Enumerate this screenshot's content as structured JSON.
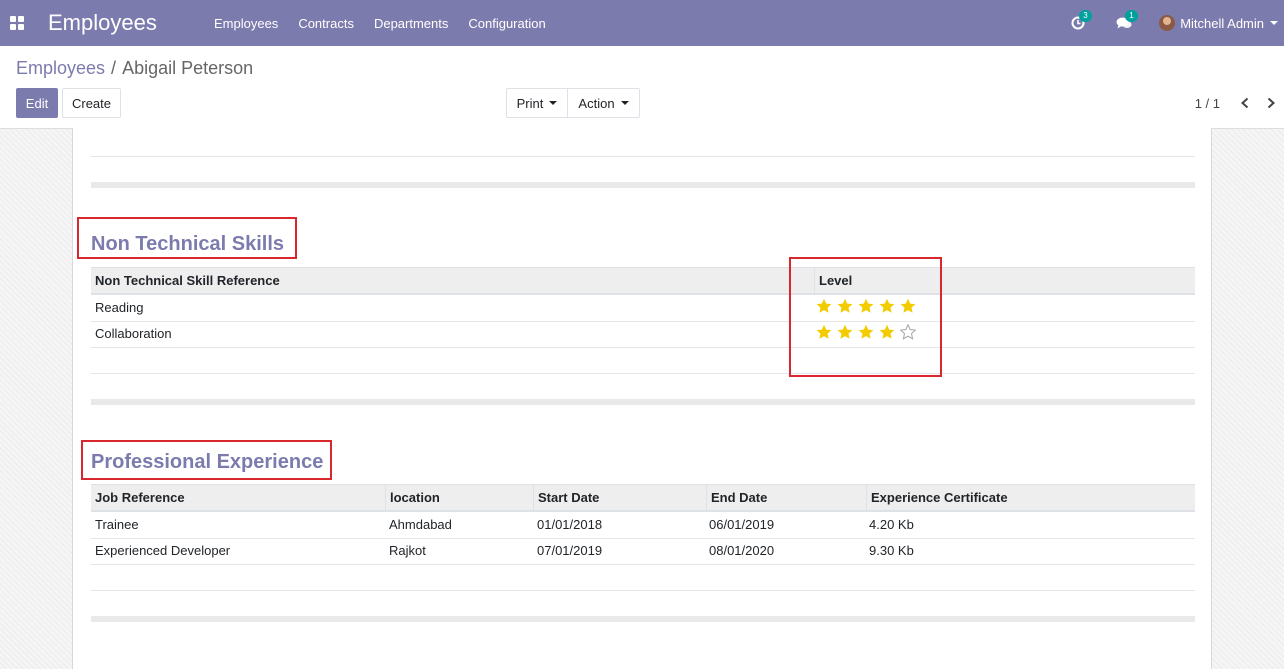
{
  "app": {
    "title": "Employees",
    "menu": [
      "Employees",
      "Contracts",
      "Departments",
      "Configuration"
    ],
    "activity_count": "3",
    "message_count": "1",
    "user_name": "Mitchell Admin"
  },
  "colors": {
    "brand": "#7c7bad",
    "highlight": "#d9272e",
    "star_filled": "#f3cc00",
    "star_empty": "#aaaaaa",
    "badge": "#00a09d"
  },
  "breadcrumb": {
    "parent": "Employees",
    "separator": "/",
    "current": "Abigail Peterson"
  },
  "toolbar": {
    "edit_label": "Edit",
    "create_label": "Create",
    "print_label": "Print",
    "action_label": "Action"
  },
  "pager": {
    "value": "1 / 1"
  },
  "non_technical": {
    "title": "Non Technical Skills",
    "columns": [
      "Non Technical Skill Reference",
      "Level"
    ],
    "rows": [
      {
        "name": "Reading",
        "level": 5
      },
      {
        "name": "Collaboration",
        "level": 4
      }
    ],
    "max_level": 5
  },
  "experience": {
    "title": "Professional Experience",
    "columns": [
      "Job Reference",
      "location",
      "Start Date",
      "End Date",
      "Experience Certificate"
    ],
    "rows": [
      [
        "Trainee",
        "Ahmdabad",
        "01/01/2018",
        "06/01/2019",
        "4.20 Kb"
      ],
      [
        "Experienced Developer",
        "Rajkot",
        "07/01/2019",
        "08/01/2020",
        "9.30 Kb"
      ]
    ]
  }
}
